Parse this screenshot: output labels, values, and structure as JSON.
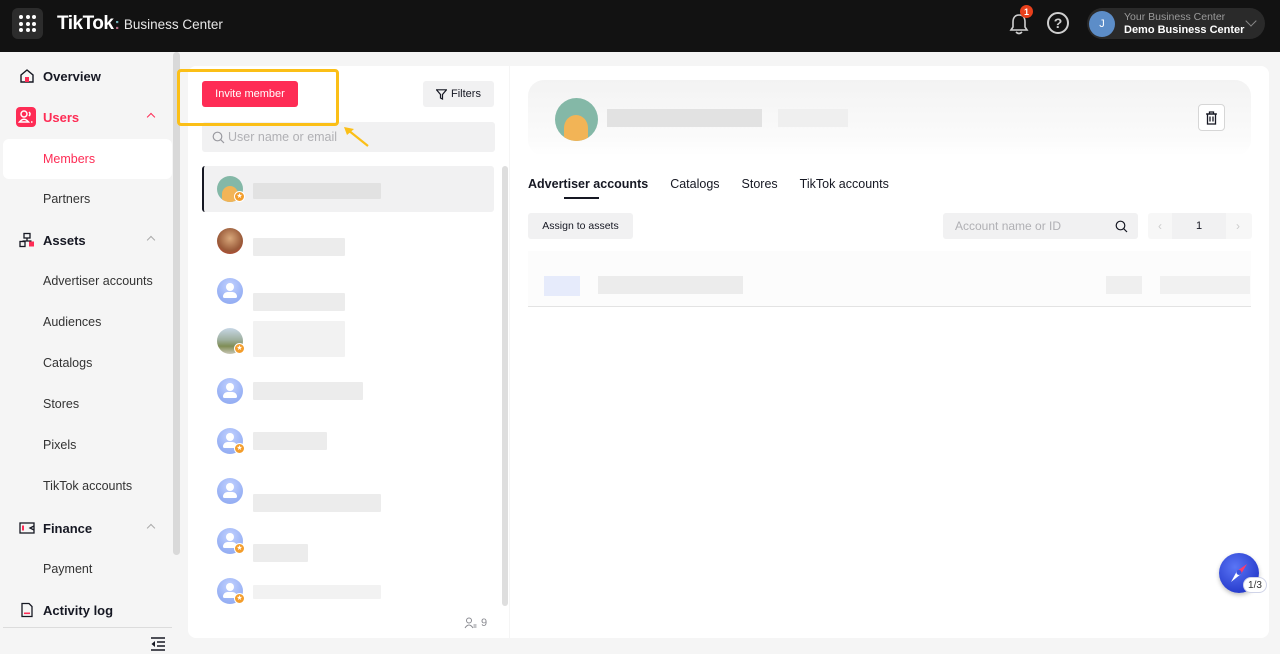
{
  "header": {
    "logo_primary": "TikTok",
    "logo_separator": ":",
    "logo_secondary": "Business Center",
    "notification_count": "1",
    "help_symbol": "?",
    "account": {
      "avatar_initial": "J",
      "label": "Your Business Center",
      "name": "Demo Business Center"
    }
  },
  "sidebar": {
    "items": [
      {
        "label": "Overview",
        "icon": "home-icon",
        "type": "section"
      },
      {
        "label": "Users",
        "icon": "users-icon",
        "type": "section",
        "expanded": true,
        "active": true
      },
      {
        "label": "Members",
        "type": "sub",
        "selected": true
      },
      {
        "label": "Partners",
        "type": "sub"
      },
      {
        "label": "Assets",
        "icon": "assets-icon",
        "type": "section",
        "expanded": true
      },
      {
        "label": "Advertiser accounts",
        "type": "sub"
      },
      {
        "label": "Audiences",
        "type": "sub"
      },
      {
        "label": "Catalogs",
        "type": "sub"
      },
      {
        "label": "Stores",
        "type": "sub"
      },
      {
        "label": "Pixels",
        "type": "sub"
      },
      {
        "label": "TikTok accounts",
        "type": "sub"
      },
      {
        "label": "Finance",
        "icon": "wallet-icon",
        "type": "section",
        "expanded": true
      },
      {
        "label": "Payment",
        "type": "sub"
      },
      {
        "label": "Activity log",
        "icon": "document-icon",
        "type": "section"
      }
    ]
  },
  "members_panel": {
    "invite_label": "Invite member",
    "filters_label": "Filters",
    "search_placeholder": "User name or email",
    "member_count": "9",
    "members": [
      {
        "avatar": "monster",
        "admin": true,
        "selected": true
      },
      {
        "avatar": "cat",
        "admin": false
      },
      {
        "avatar": "default",
        "admin": false
      },
      {
        "avatar": "photo",
        "admin": true
      },
      {
        "avatar": "default",
        "admin": false
      },
      {
        "avatar": "default",
        "admin": true
      },
      {
        "avatar": "default",
        "admin": false
      },
      {
        "avatar": "default",
        "admin": true
      },
      {
        "avatar": "default",
        "admin": true
      }
    ]
  },
  "detail_panel": {
    "tabs": [
      "Advertiser accounts",
      "Catalogs",
      "Stores",
      "TikTok accounts"
    ],
    "active_tab": "Advertiser accounts",
    "assign_label": "Assign to assets",
    "account_search_placeholder": "Account name or ID",
    "pager": {
      "prev": "‹",
      "page": "1",
      "next": "›"
    }
  },
  "guide_widget": {
    "progress": "1/3"
  },
  "colors": {
    "accent": "#fe2c55",
    "highlight": "#fbbf17",
    "topbar": "#121212"
  }
}
